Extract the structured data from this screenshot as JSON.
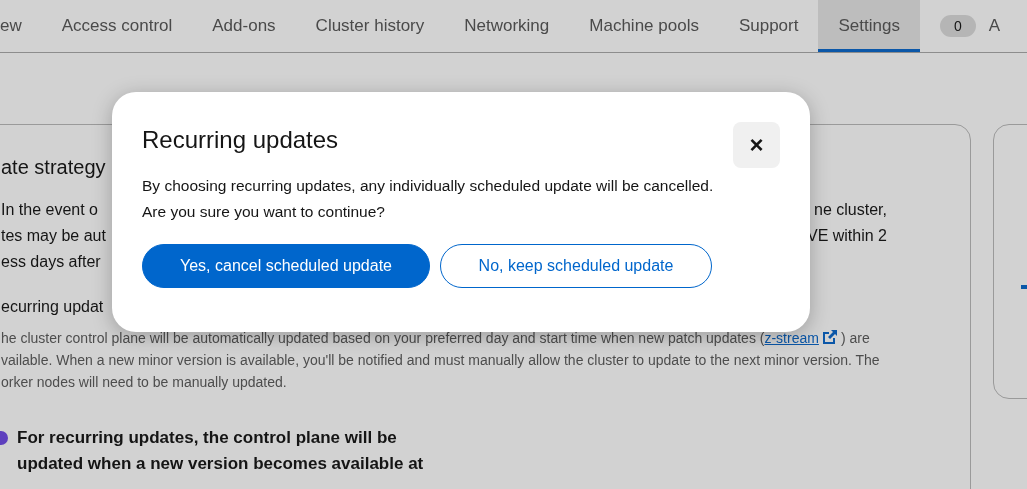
{
  "tabs": [
    {
      "label": "ew",
      "selected": false
    },
    {
      "label": "Access control",
      "selected": false
    },
    {
      "label": "Add-ons",
      "selected": false
    },
    {
      "label": "Cluster history",
      "selected": false
    },
    {
      "label": "Networking",
      "selected": false
    },
    {
      "label": "Machine pools",
      "selected": false
    },
    {
      "label": "Support",
      "selected": false
    },
    {
      "label": "Settings",
      "selected": true
    },
    {
      "label": "A",
      "count": "0",
      "selected": false
    }
  ],
  "update_card": {
    "heading": "ate strategy",
    "lines": [
      {
        "left": "In the event o",
        "right": "ne cluster,"
      },
      {
        "left": "tes may be aut",
        "right": "VE within 2"
      },
      {
        "left": "ess days after"
      }
    ],
    "option_label": "ecurring updat",
    "description": {
      "before": "he cluster control plane will be automatically updated based on your preferred day and start time when new patch updates (",
      "link": "z-stream",
      "after": ") are\nvailable. When a new minor version is available, you'll be notified and must manually allow the cluster to update to the next minor version. The\norker nodes will need to be manually updated."
    },
    "note": "For recurring updates, the control plane will be\nupdated when a new version becomes available at"
  },
  "modal": {
    "title": "Recurring updates",
    "close": "×",
    "body": "By choosing recurring updates, any individually scheduled update will be cancelled.\nAre you sure you want to continue?",
    "buttons": [
      {
        "label": "Yes, cancel scheduled update",
        "kind": "primary"
      },
      {
        "label": "No, keep scheduled update",
        "kind": "secondary"
      }
    ]
  }
}
